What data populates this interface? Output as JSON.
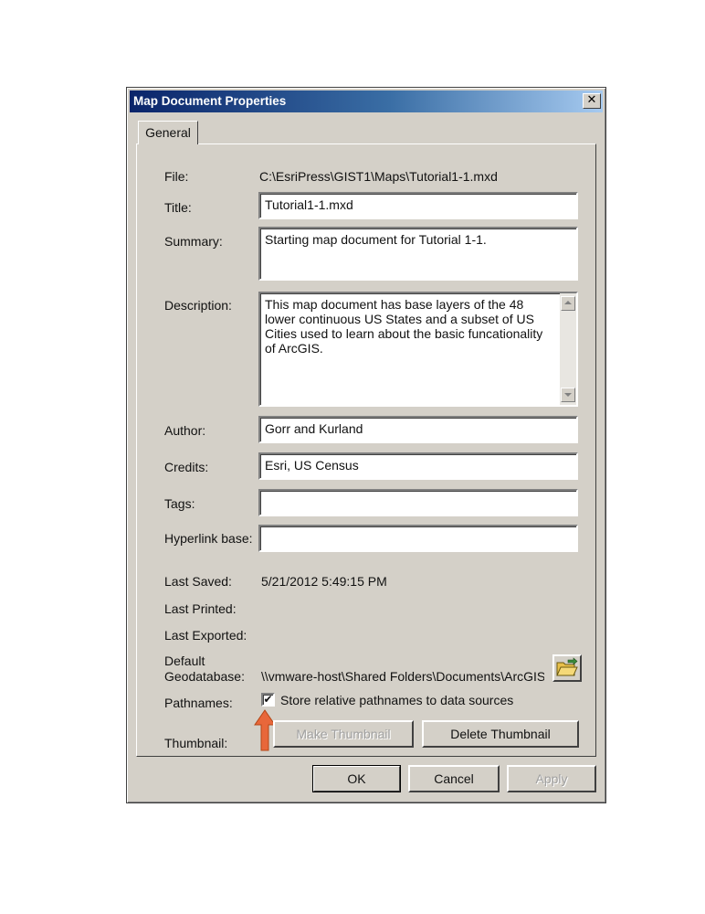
{
  "dialog": {
    "title": "Map Document Properties",
    "close_glyph": "✕",
    "tab_label": "General"
  },
  "fields": {
    "file_label": "File:",
    "file_value": "C:\\EsriPress\\GIST1\\Maps\\Tutorial1-1.mxd",
    "title_label": "Title:",
    "title_value": "Tutorial1-1.mxd",
    "summary_label": "Summary:",
    "summary_value": "Starting map document for Tutorial 1-1.",
    "description_label": "Description:",
    "description_value": "This map document has base layers of the 48 lower continuous US States and a subset of US Cities used to learn about the basic funcationality of ArcGIS.",
    "author_label": "Author:",
    "author_value": "Gorr and Kurland",
    "credits_label": "Credits:",
    "credits_value": "Esri, US Census",
    "tags_label": "Tags:",
    "tags_value": "",
    "hyperlink_label": "Hyperlink base:",
    "hyperlink_value": "",
    "last_saved_label": "Last Saved:",
    "last_saved_value": "5/21/2012 5:49:15 PM",
    "last_printed_label": "Last Printed:",
    "last_exported_label": "Last Exported:",
    "default_gdb_label_1": "Default",
    "default_gdb_label_2": "Geodatabase:",
    "default_gdb_value": "\\\\vmware-host\\Shared Folders\\Documents\\ArcGIS",
    "pathnames_label": "Pathnames:",
    "pathnames_checkbox_label": "Store relative pathnames to data sources",
    "pathnames_checked": true,
    "thumbnail_label": "Thumbnail:"
  },
  "buttons": {
    "make_thumbnail": "Make Thumbnail",
    "delete_thumbnail": "Delete Thumbnail",
    "ok": "OK",
    "cancel": "Cancel",
    "apply": "Apply"
  },
  "icons": {
    "folder": "folder-open-icon",
    "annotation_arrow": "orange-up-arrow-icon"
  },
  "colors": {
    "titlebar_start": "#0a246a",
    "titlebar_end": "#a6caf0",
    "annotation_arrow": "#e8673a"
  }
}
